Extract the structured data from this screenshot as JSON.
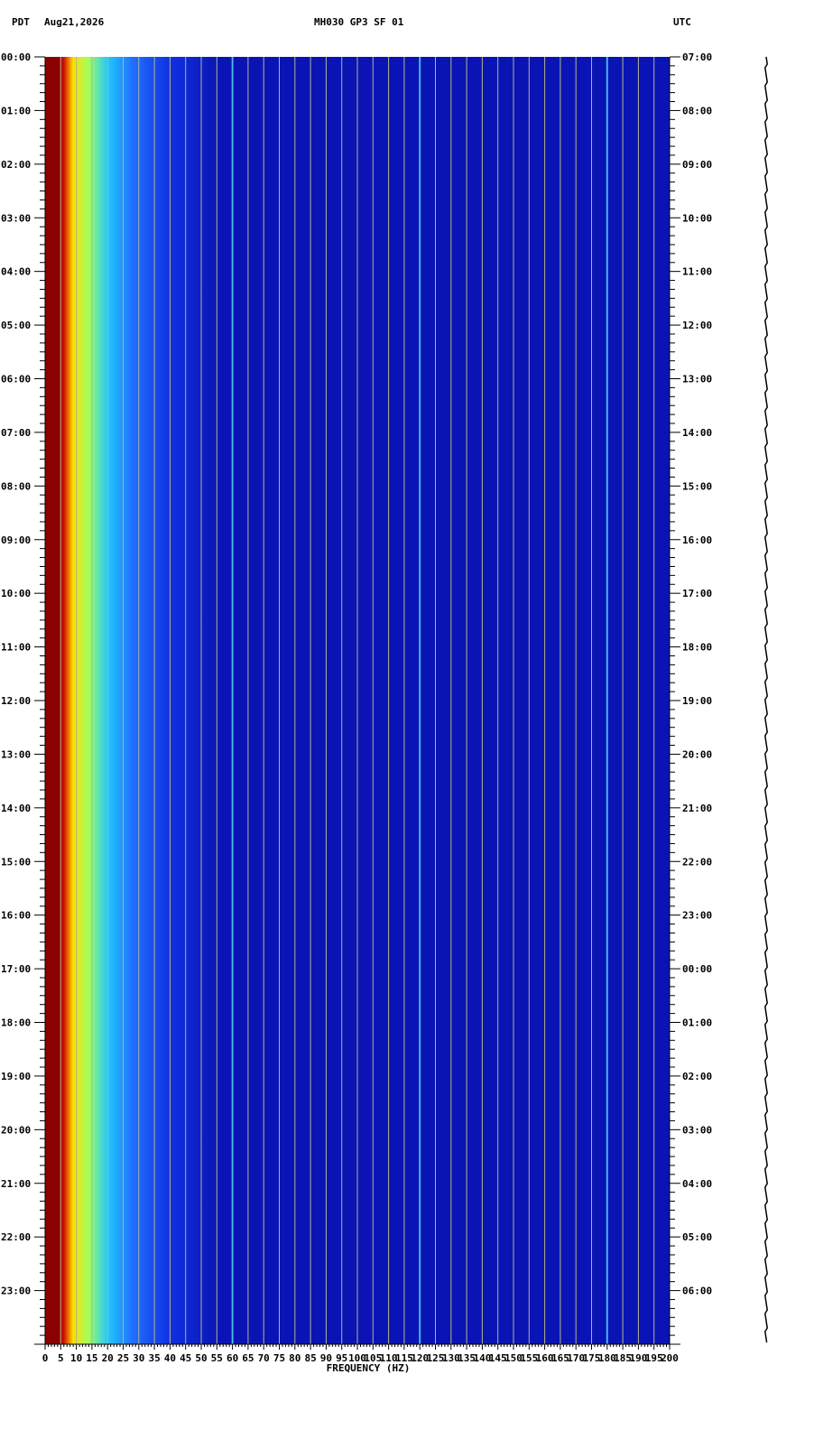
{
  "header": {
    "left_tz": "PDT",
    "date": "Aug21,2026",
    "station": "MH030 GP3 SF 01",
    "right_tz": "UTC"
  },
  "chart_data": {
    "type": "heatmap",
    "title": "MH030 GP3 SF 01",
    "xlabel": "FREQUENCY (HZ)",
    "xlim": [
      0,
      200
    ],
    "x_ticks": [
      "0",
      "5",
      "10",
      "15",
      "20",
      "25",
      "30",
      "35",
      "40",
      "45",
      "50",
      "55",
      "60",
      "65",
      "70",
      "75",
      "80",
      "85",
      "90",
      "95",
      "100",
      "105",
      "110",
      "115",
      "120",
      "125",
      "130",
      "135",
      "140",
      "145",
      "150",
      "155",
      "160",
      "165",
      "170",
      "175",
      "180",
      "185",
      "190",
      "195",
      "200"
    ],
    "y_left_label": "PDT",
    "y_left_ticks": [
      "00:00",
      "01:00",
      "02:00",
      "03:00",
      "04:00",
      "05:00",
      "06:00",
      "07:00",
      "08:00",
      "09:00",
      "10:00",
      "11:00",
      "12:00",
      "13:00",
      "14:00",
      "15:00",
      "16:00",
      "17:00",
      "18:00",
      "19:00",
      "20:00",
      "21:00",
      "22:00",
      "23:00"
    ],
    "y_right_label": "UTC",
    "y_right_ticks": [
      "07:00",
      "08:00",
      "09:00",
      "10:00",
      "11:00",
      "12:00",
      "13:00",
      "14:00",
      "15:00",
      "16:00",
      "17:00",
      "18:00",
      "19:00",
      "20:00",
      "21:00",
      "22:00",
      "23:00",
      "00:00",
      "01:00",
      "02:00",
      "03:00",
      "04:00",
      "05:00",
      "06:00"
    ],
    "grid": true,
    "persistent_lines_hz": [
      60,
      120,
      180
    ],
    "colors": {
      "background": "#0a14b4",
      "low_freq": "#8b0000",
      "grid": "#b4b48c",
      "trace": "#000000"
    }
  }
}
